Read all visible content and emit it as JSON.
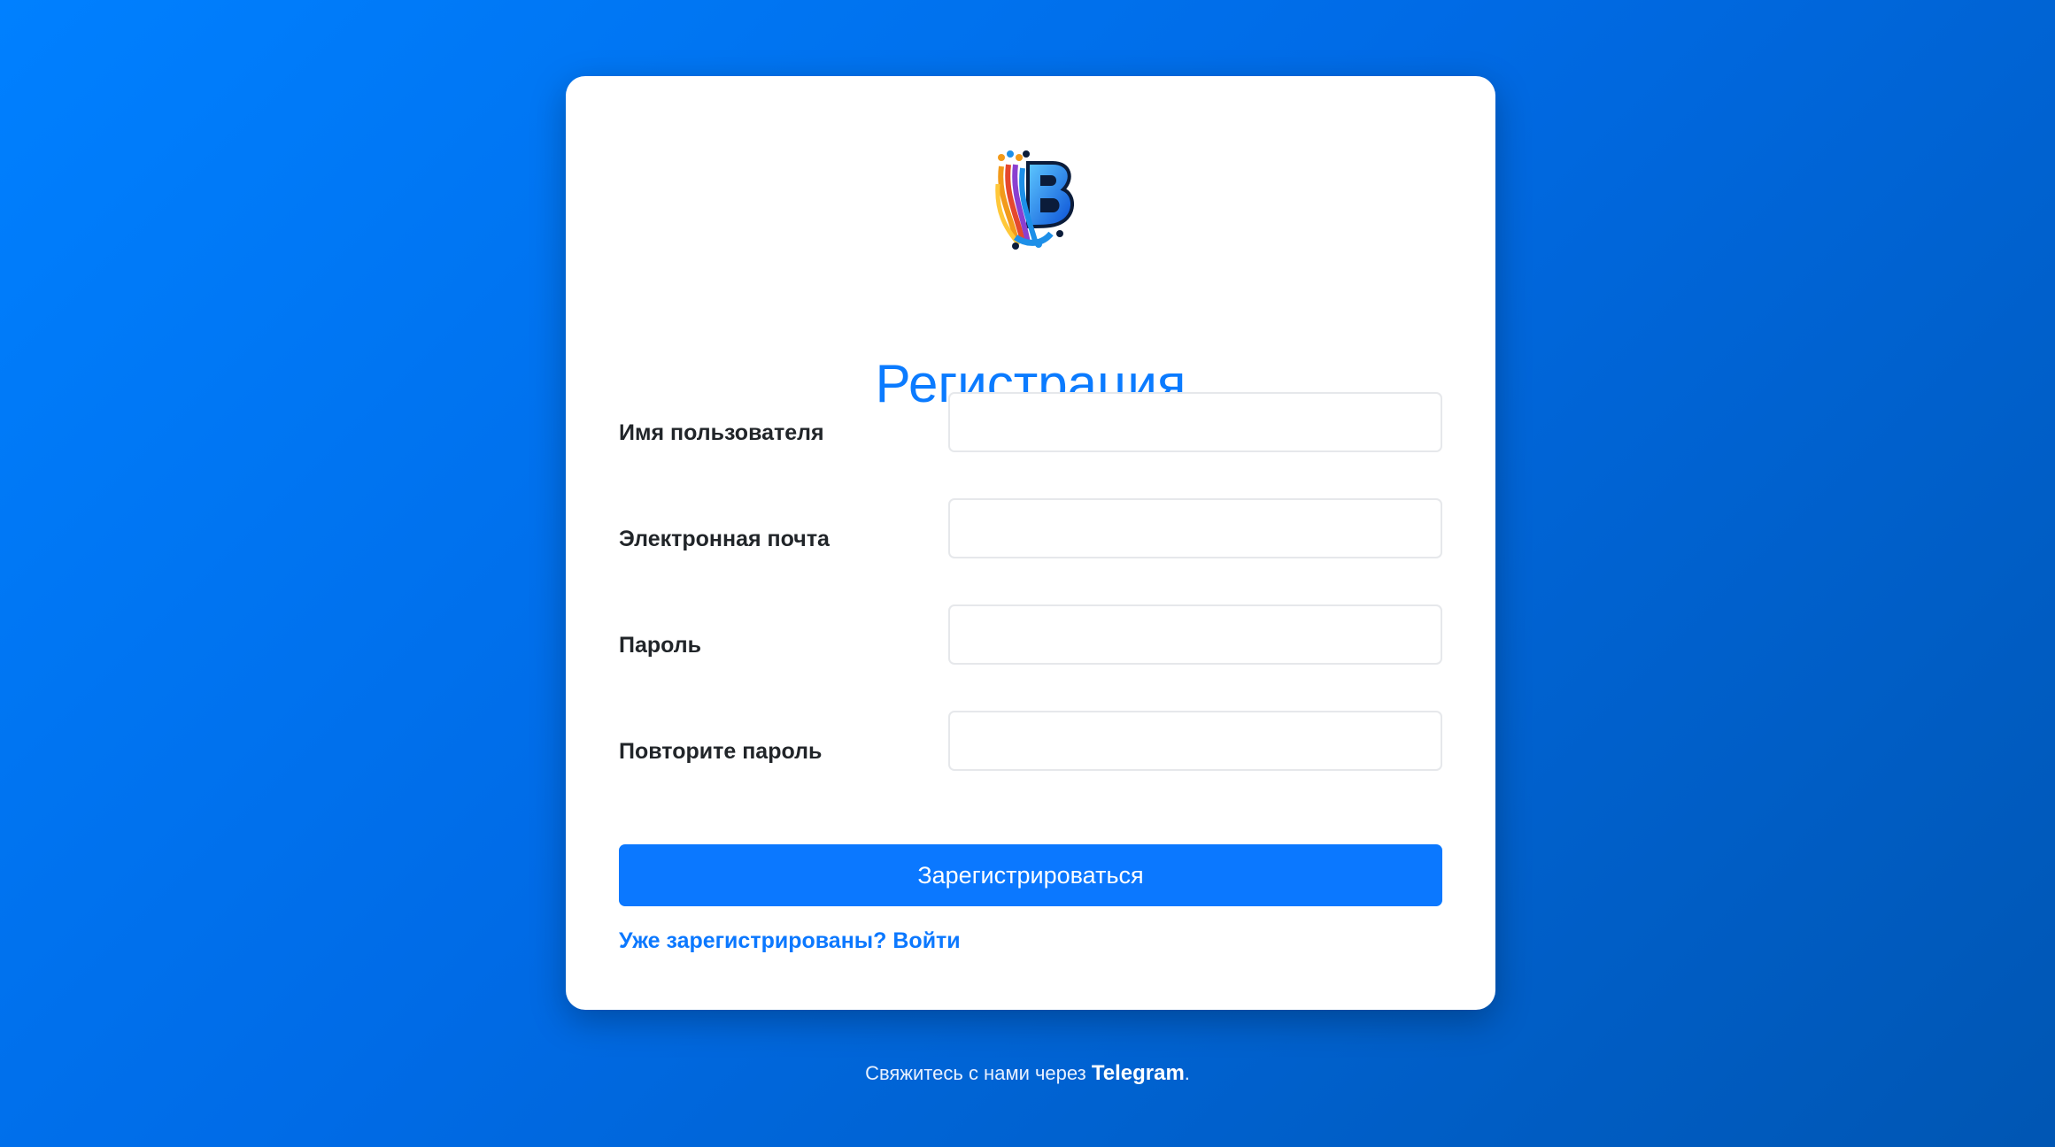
{
  "form": {
    "logo_icon": "brand-logo-b-icon",
    "title": "Регистрация",
    "fields": [
      {
        "label": "Имя пользователя",
        "value": "",
        "placeholder": ""
      },
      {
        "label": "Электронная почта",
        "value": "",
        "placeholder": ""
      },
      {
        "label": "Пароль",
        "value": "",
        "placeholder": ""
      },
      {
        "label": "Повторите пароль",
        "value": "",
        "placeholder": ""
      }
    ],
    "submit_label": "Зарегистрироваться",
    "login_link": "Уже зарегистрированы? Войти"
  },
  "footer": {
    "text_before": "Свяжитесь с нами через ",
    "link_label": "Telegram",
    "text_after": "."
  },
  "colors": {
    "accent": "#0b78ff",
    "background_gradient_start": "#0080ff",
    "background_gradient_end": "#0056b3",
    "card_background": "#ffffff"
  }
}
